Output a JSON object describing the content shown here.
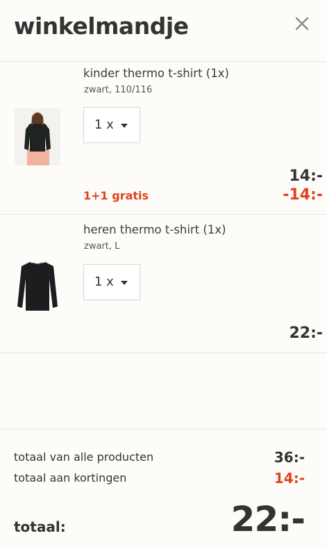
{
  "header": {
    "title": "winkelmandje",
    "close_icon": "close-icon"
  },
  "items": [
    {
      "name": "kinder thermo t-shirt (1x)",
      "variant": "zwart, 110/116",
      "quantity": "1 x",
      "price": "14:-",
      "promo": "1+1 gratis",
      "discount": "-14:-",
      "image_icon": "girl-black-thermo-shirt-photo"
    },
    {
      "name": "heren thermo t-shirt (1x)",
      "variant": "zwart, L",
      "quantity": "1 x",
      "price": "22:-",
      "image_icon": "black-longsleeve-shirt-photo"
    }
  ],
  "summary": {
    "products_label": "totaal van alle producten",
    "products_value": "36:-",
    "discounts_label": "totaal aan kortingen",
    "discounts_value": "14:-",
    "total_label": "totaal:",
    "total_value": "22:-"
  },
  "colors": {
    "accent_red": "#e2401c",
    "text": "#333333",
    "background": "#fdfcf9"
  }
}
